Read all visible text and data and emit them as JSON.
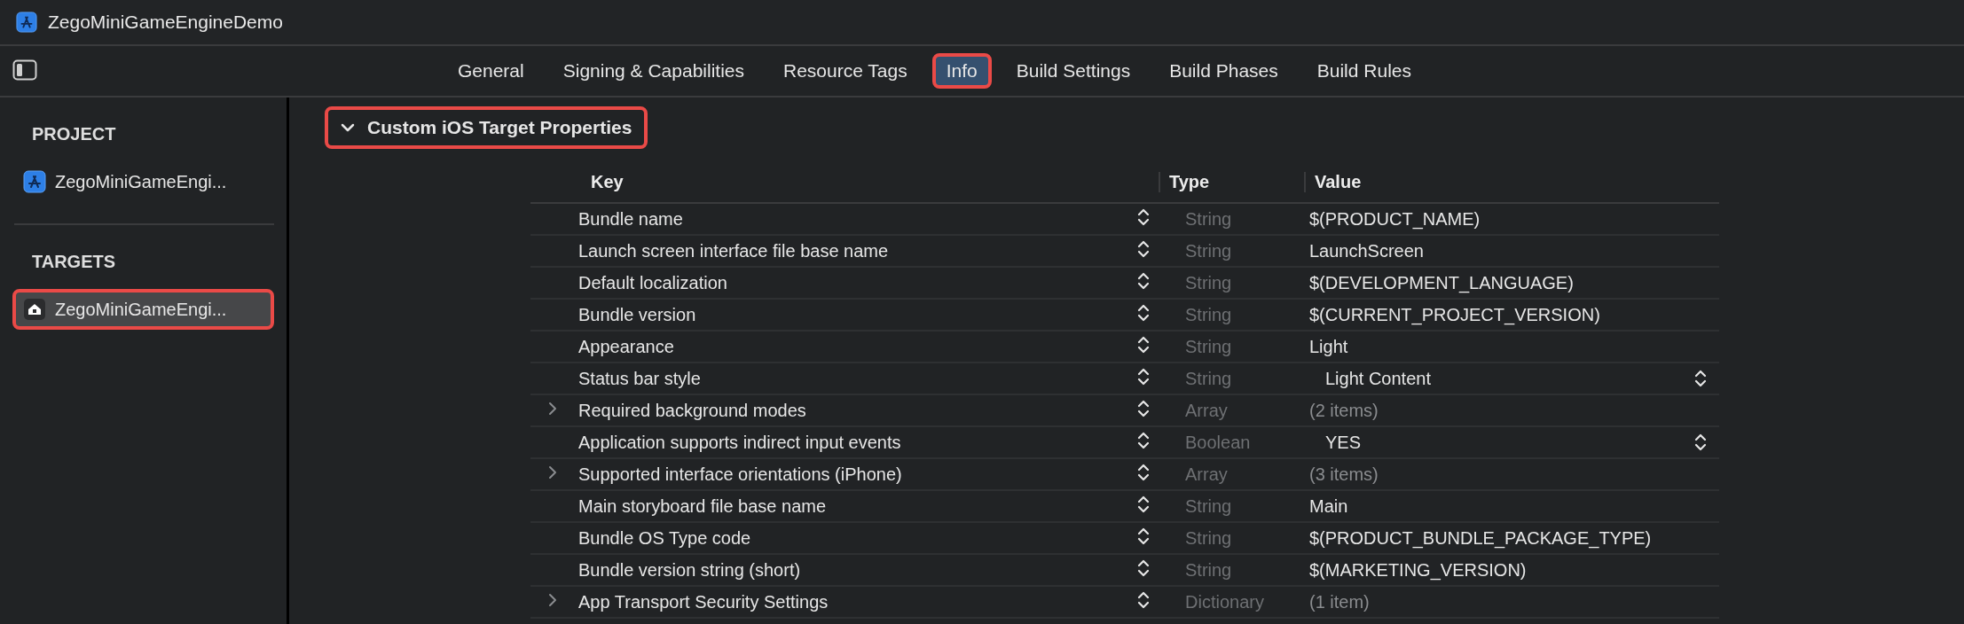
{
  "window": {
    "title": "ZegoMiniGameEngineDemo"
  },
  "tabs": [
    {
      "label": "General",
      "selected": false,
      "highlighted": false
    },
    {
      "label": "Signing & Capabilities",
      "selected": false,
      "highlighted": false
    },
    {
      "label": "Resource Tags",
      "selected": false,
      "highlighted": false
    },
    {
      "label": "Info",
      "selected": true,
      "highlighted": true
    },
    {
      "label": "Build Settings",
      "selected": false,
      "highlighted": false
    },
    {
      "label": "Build Phases",
      "selected": false,
      "highlighted": false
    },
    {
      "label": "Build Rules",
      "selected": false,
      "highlighted": false
    }
  ],
  "sidebar": {
    "sections": [
      {
        "title": "PROJECT",
        "items": [
          {
            "label": "ZegoMiniGameEngi...",
            "kind": "project",
            "selected": false,
            "highlighted": false
          }
        ]
      },
      {
        "title": "TARGETS",
        "items": [
          {
            "label": "ZegoMiniGameEngi...",
            "kind": "target",
            "selected": true,
            "highlighted": true
          }
        ]
      }
    ]
  },
  "section": {
    "title": "Custom iOS Target Properties",
    "expanded": true,
    "highlighted": true
  },
  "table": {
    "columns": [
      "Key",
      "Type",
      "Value"
    ],
    "rows": [
      {
        "key": "Bundle name",
        "type": "String",
        "value": "$(PRODUCT_NAME)",
        "expandable": false,
        "kind": "text"
      },
      {
        "key": "Launch screen interface file base name",
        "type": "String",
        "value": "LaunchScreen",
        "expandable": false,
        "kind": "text"
      },
      {
        "key": "Default localization",
        "type": "String",
        "value": "$(DEVELOPMENT_LANGUAGE)",
        "expandable": false,
        "kind": "text"
      },
      {
        "key": "Bundle version",
        "type": "String",
        "value": "$(CURRENT_PROJECT_VERSION)",
        "expandable": false,
        "kind": "text"
      },
      {
        "key": "Appearance",
        "type": "String",
        "value": "Light",
        "expandable": false,
        "kind": "text"
      },
      {
        "key": "Status bar style",
        "type": "String",
        "value": "Light Content",
        "expandable": false,
        "kind": "popup"
      },
      {
        "key": "Required background modes",
        "type": "Array",
        "value": "(2 items)",
        "expandable": true,
        "kind": "count"
      },
      {
        "key": "Application supports indirect input events",
        "type": "Boolean",
        "value": "YES",
        "expandable": false,
        "kind": "popup"
      },
      {
        "key": "Supported interface orientations (iPhone)",
        "type": "Array",
        "value": "(3 items)",
        "expandable": true,
        "kind": "count"
      },
      {
        "key": "Main storyboard file base name",
        "type": "String",
        "value": "Main",
        "expandable": false,
        "kind": "text"
      },
      {
        "key": "Bundle OS Type code",
        "type": "String",
        "value": "$(PRODUCT_BUNDLE_PACKAGE_TYPE)",
        "expandable": false,
        "kind": "text"
      },
      {
        "key": "Bundle version string (short)",
        "type": "String",
        "value": "$(MARKETING_VERSION)",
        "expandable": false,
        "kind": "text"
      },
      {
        "key": "App Transport Security Settings",
        "type": "Dictionary",
        "value": "(1 item)",
        "expandable": true,
        "kind": "count"
      }
    ]
  }
}
